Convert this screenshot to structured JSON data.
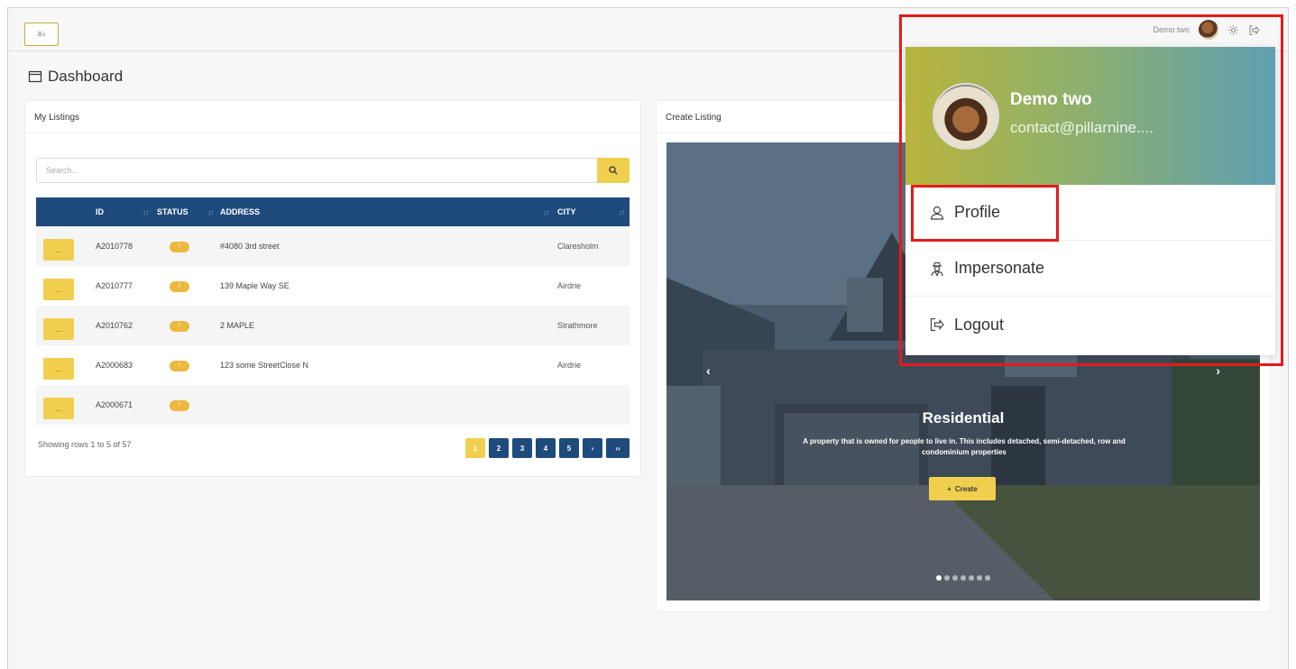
{
  "page": {
    "title": "Dashboard"
  },
  "topbar": {
    "menu_toggle_label": "≡‹"
  },
  "user": {
    "display_name": "Demo two",
    "email": "contact@pillarnine...."
  },
  "dropdown": {
    "items": [
      {
        "label": "Profile",
        "icon": "person-icon"
      },
      {
        "label": "Impersonate",
        "icon": "incognito-icon"
      },
      {
        "label": "Logout",
        "icon": "logout-icon"
      }
    ]
  },
  "listings": {
    "title": "My Listings",
    "search_placeholder": "Search...",
    "columns": [
      "ID",
      "STATUS",
      "ADDRESS",
      "CITY"
    ],
    "rows": [
      {
        "action": "...",
        "id": "A2010778",
        "status": "!",
        "address": "#4080 3rd street",
        "city": "Claresholm"
      },
      {
        "action": "...",
        "id": "A2010777",
        "status": "!",
        "address": "139 Maple Way SE",
        "city": "Airdrie"
      },
      {
        "action": "...",
        "id": "A2010762",
        "status": "!",
        "address": "2 MAPLE",
        "city": "Strathmore"
      },
      {
        "action": "...",
        "id": "A2000683",
        "status": "!",
        "address": "123 some StreetClose N",
        "city": "Airdrie"
      },
      {
        "action": "...",
        "id": "A2000671",
        "status": "!",
        "address": "",
        "city": ""
      }
    ],
    "footer_text": "Showing rows 1 to 5 of 57",
    "pagination": [
      "1",
      "2",
      "3",
      "4",
      "5",
      "›",
      "››"
    ],
    "active_page": "1"
  },
  "create_listing": {
    "title": "Create Listing",
    "slide": {
      "title": "Residential",
      "description": "A property that is owned for people to live in. This includes detached, semi-detached, row and condominium properties",
      "button_label": "Create",
      "prev_label": "‹",
      "next_label": "›"
    },
    "slide_count": 7,
    "active_slide": 0
  },
  "colors": {
    "accent_yellow": "#f1cf4e",
    "table_header": "#1f4a7c",
    "highlight_red": "#e51a1a"
  }
}
